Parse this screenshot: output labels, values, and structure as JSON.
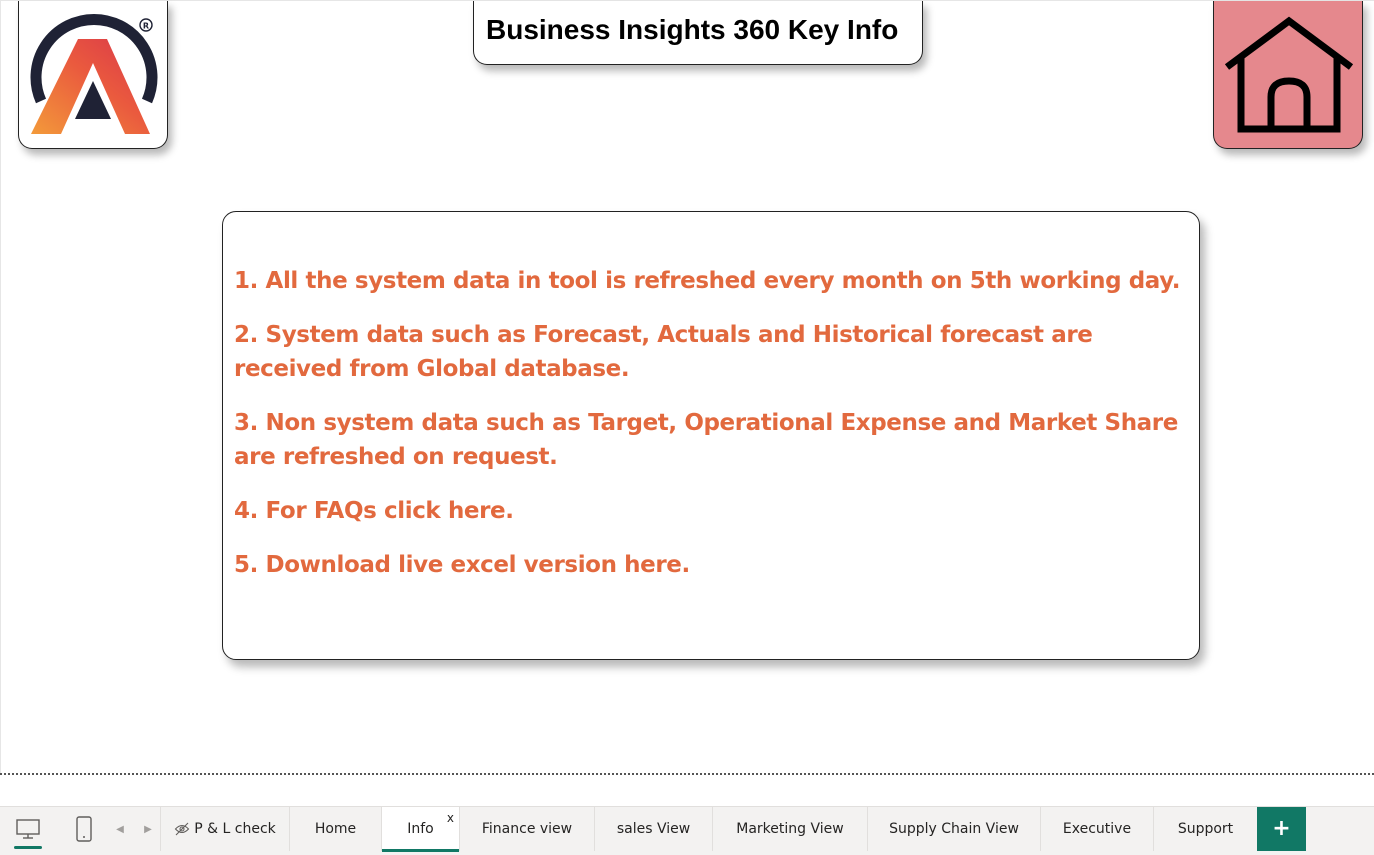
{
  "header": {
    "title": "Business Insights 360 Key Info",
    "home_icon": "home-icon",
    "logo_icon": "atliq-logo"
  },
  "info": {
    "items": [
      "1. All the system data in tool is refreshed every month on 5th working day.",
      "2.  System data such as Forecast, Actuals and Historical forecast are received from Global database.",
      "3.  Non system data such as Target, Operational Expense and Market Share are refreshed on request.",
      "4. For FAQs click here.",
      "5. Download live excel version here."
    ]
  },
  "tabbar": {
    "view_buttons": [
      "desktop-icon",
      "phone-icon"
    ],
    "tabs": [
      {
        "label": "P & L check",
        "hidden": true
      },
      {
        "label": "Home"
      },
      {
        "label": "Info",
        "active": true
      },
      {
        "label": "Finance view"
      },
      {
        "label": "sales View"
      },
      {
        "label": "Marketing View"
      },
      {
        "label": "Supply Chain View"
      },
      {
        "label": "Executive"
      },
      {
        "label": "Support"
      }
    ],
    "close_label": "x",
    "add_label": "+"
  },
  "colors": {
    "accent": "#117865",
    "info_text": "#e2693e",
    "home_card": "#e5888d",
    "logo_orange": "#f08a3a",
    "logo_red": "#d9364a",
    "logo_dark": "#1f2235"
  }
}
